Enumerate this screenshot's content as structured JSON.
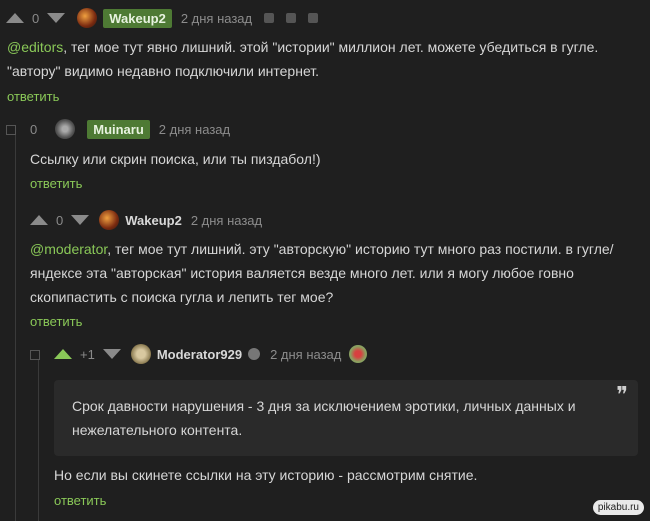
{
  "c1": {
    "score": "0",
    "nick": "Wakeup2",
    "time": "2 дня назад",
    "mention": "@editors",
    "text": ", тег мое тут явно лишний. этой \"истории\" миллион лет. можете убедиться в гугле. \"автору\" видимо недавно подключили интернет.",
    "reply": "ответить"
  },
  "c2": {
    "score": "0",
    "nick": "Muinaru",
    "time": "2 дня назад",
    "text": "Ссылку или скрин поиска, или ты пиздабол!)",
    "reply": "ответить"
  },
  "c3": {
    "score": "0",
    "nick": "Wakeup2",
    "time": "2 дня назад",
    "mention": "@moderator",
    "text": ", тег мое тут лишний. эту \"авторскую\" историю тут много раз постили. в гугле/ яндексе эта \"авторская\" история валяется везде много лет. или я могу любое говно скопипастить с поиска гугла и лепить тег мое?",
    "reply": "ответить"
  },
  "c4": {
    "score": "+1",
    "nick": "Moderator929",
    "time": "2 дня назад",
    "quote": "Срок давности нарушения - 3 дня за исключением эротики, личных данных и нежелательного контента.",
    "quote_mark": "❞",
    "text": "Но если вы скинете ссылки на эту историю - рассмотрим снятие.",
    "reply": "ответить"
  },
  "watermark": "pikabu.ru",
  "colors": {
    "accent": "#8ac858",
    "bg": "#1f1f1f",
    "tag": "#4e7a34"
  }
}
